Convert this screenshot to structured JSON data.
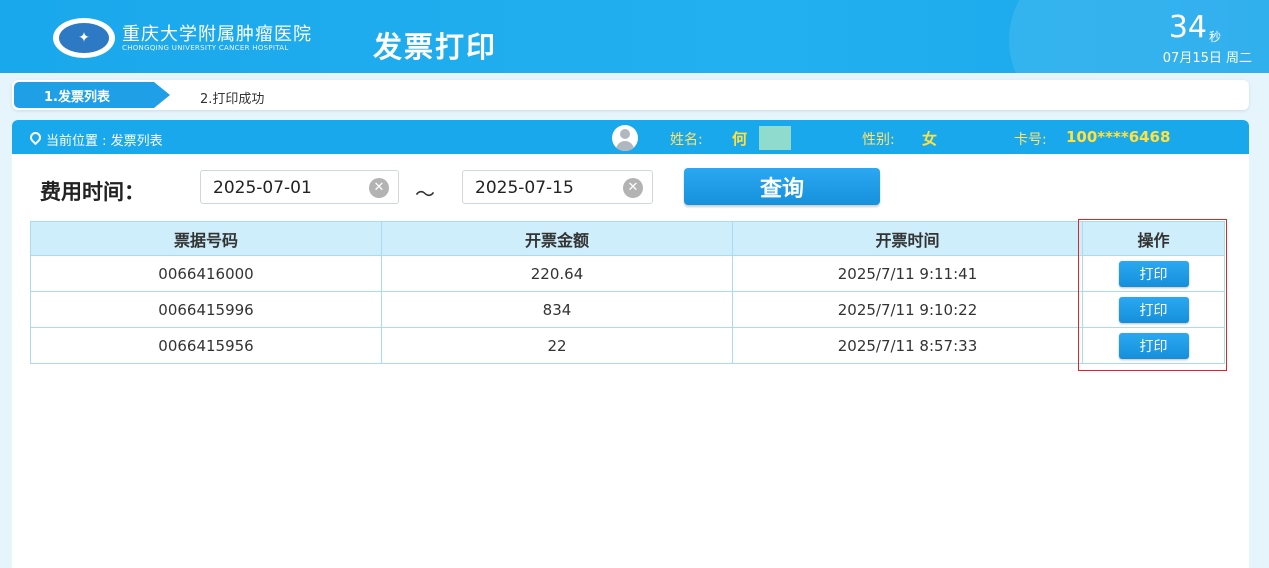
{
  "header": {
    "hospital_name_cn": "重庆大学附属肿瘤医院",
    "hospital_name_en": "CHONGQING UNIVERSITY CANCER HOSPITAL",
    "page_title": "发票打印",
    "countdown_value": "34",
    "countdown_unit": "秒",
    "date": "07月15日 周二"
  },
  "steps": [
    {
      "label": "1.发票列表",
      "active": true
    },
    {
      "label": "2.打印成功",
      "active": false
    }
  ],
  "location": {
    "text": "当前位置 : 发票列表"
  },
  "patient": {
    "name_label": "姓名:",
    "name_value": "何",
    "gender_label": "性别:",
    "gender_value": "女",
    "card_label": "卡号:",
    "card_value": "100****6468"
  },
  "search": {
    "label": "费用时间：",
    "start_date": "2025-07-01",
    "separator": "～",
    "end_date": "2025-07-15",
    "query_label": "查询"
  },
  "table": {
    "columns": [
      "票据号码",
      "开票金额",
      "开票时间",
      "操作"
    ],
    "rows": [
      {
        "invoice_no": "0066416000",
        "amount": "220.64",
        "time": "2025/7/11 9:11:41",
        "action": "打印"
      },
      {
        "invoice_no": "0066415996",
        "amount": "834",
        "time": "2025/7/11 9:10:22",
        "action": "打印"
      },
      {
        "invoice_no": "0066415956",
        "amount": "22",
        "time": "2025/7/11 8:57:33",
        "action": "打印"
      }
    ]
  },
  "colors": {
    "header_blue": "#1aa8ec",
    "highlight_red": "#e02424",
    "patient_info_yellow": "#ffe23d"
  }
}
